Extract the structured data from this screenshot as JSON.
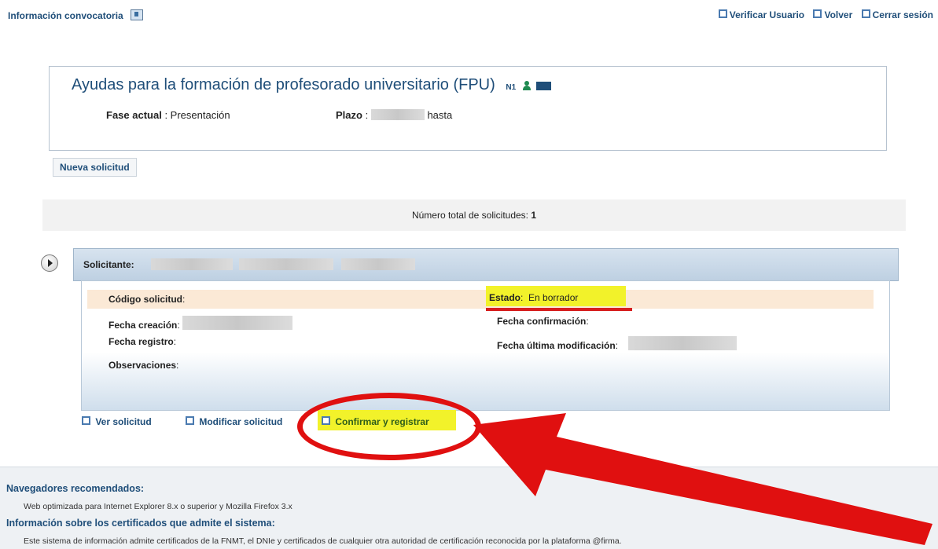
{
  "top": {
    "info_link": "Información convocatoria",
    "links": [
      "Verificar Usuario",
      "Volver",
      "Cerrar sesión"
    ]
  },
  "convocatoria": {
    "title": "Ayudas para la formación de profesorado universitario (FPU)",
    "level_badge": "N1",
    "fase_label": "Fase actual",
    "fase_value": "Presentación",
    "plazo_label": "Plazo",
    "plazo_suffix": "hasta"
  },
  "nueva_solicitud": "Nueva solicitud",
  "total": {
    "label": "Número total de solicitudes:",
    "value": "1"
  },
  "solicitud": {
    "solicitante_label": "Solicitante:",
    "codigo_label": "Código solicitud",
    "estado_label": "Estado",
    "estado_value": "En borrador",
    "fecha_creacion_label": "Fecha creación",
    "fecha_confirmacion_label": "Fecha confirmación",
    "fecha_registro_label": "Fecha registro",
    "fecha_modificacion_label": "Fecha última modificación",
    "observaciones_label": "Observaciones"
  },
  "actions": {
    "ver": "Ver solicitud",
    "modificar": "Modificar solicitud",
    "confirmar": "Confirmar y registrar"
  },
  "footer": {
    "navegadores_title": "Navegadores recomendados:",
    "navegadores_text": "Web optimizada para Internet Explorer 8.x o superior y Mozilla Firefox 3.x",
    "certificados_title": "Información sobre los certificados que admite el sistema:",
    "certificados_text": "Este sistema de información admite certificados de la FNMT, el DNIe y certificados de cualquier otra autoridad de certificación reconocida por la plataforma @firma."
  },
  "colors": {
    "link": "#1f4e79",
    "highlight": "#f2f22a",
    "annotation_red": "#e01010"
  }
}
